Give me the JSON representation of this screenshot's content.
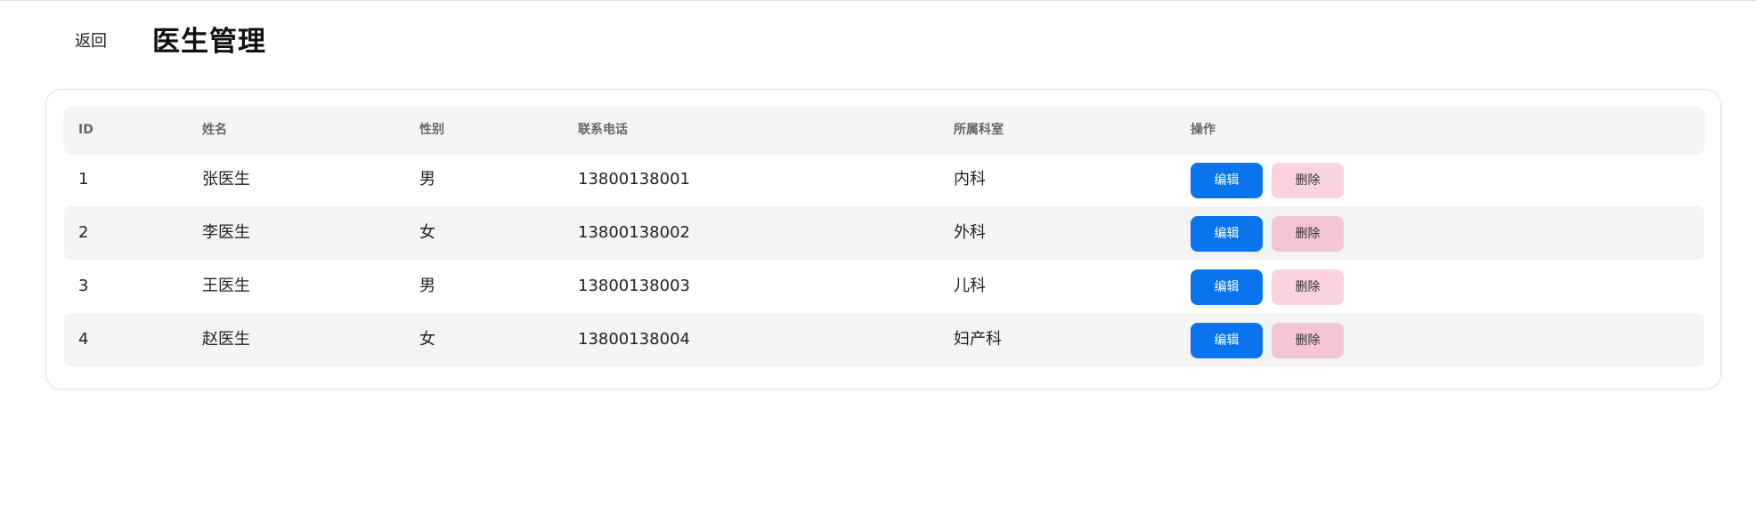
{
  "header": {
    "back_label": "返回",
    "title": "医生管理"
  },
  "table": {
    "columns": {
      "id": "ID",
      "name": "姓名",
      "gender": "性别",
      "phone": "联系电话",
      "department": "所属科室",
      "actions": "操作"
    },
    "rows": [
      {
        "id": "1",
        "name": "张医生",
        "gender": "男",
        "phone": "13800138001",
        "department": "内科"
      },
      {
        "id": "2",
        "name": "李医生",
        "gender": "女",
        "phone": "13800138002",
        "department": "外科"
      },
      {
        "id": "3",
        "name": "王医生",
        "gender": "男",
        "phone": "13800138003",
        "department": "儿科"
      },
      {
        "id": "4",
        "name": "赵医生",
        "gender": "女",
        "phone": "13800138004",
        "department": "妇产科"
      }
    ],
    "edit_label": "编辑",
    "delete_label": "删除"
  },
  "colors": {
    "edit_button": "#0a74ee",
    "delete_button": "#fbd3df",
    "header_bg": "#f4f4f4"
  }
}
